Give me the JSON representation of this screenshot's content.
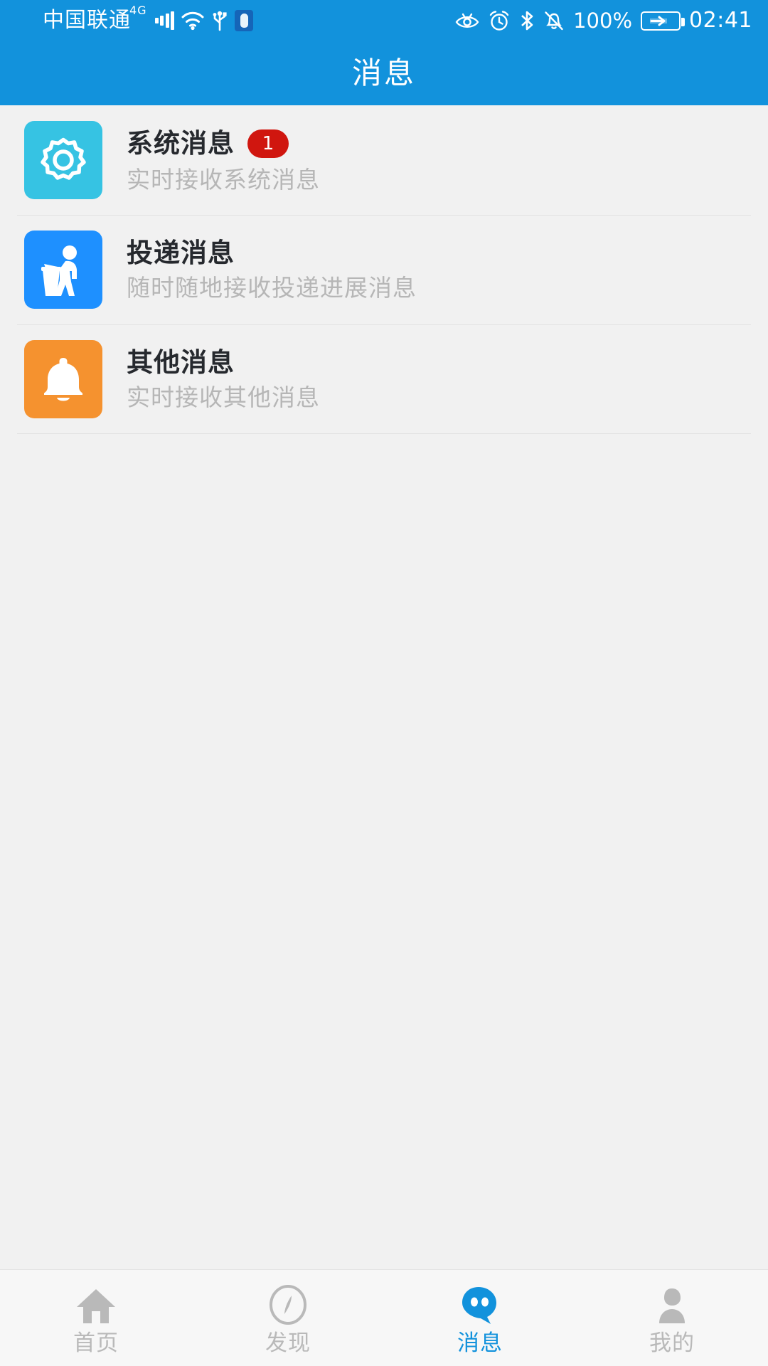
{
  "statusbar": {
    "carrier": "中国联通",
    "network_type": "4G",
    "signal_icon": "signal-bars-icon",
    "wifi_icon": "wifi-icon",
    "usb_icon": "usb-icon",
    "shield_icon": "shield-icon",
    "eye_icon": "eye-comfort-icon",
    "alarm_icon": "alarm-clock-icon",
    "bluetooth_icon": "bluetooth-icon",
    "mute_icon": "bell-muted-icon",
    "battery_percent": "100%",
    "battery_icon": "battery-charging-icon",
    "time": "02:41"
  },
  "header": {
    "title": "消息"
  },
  "main": {
    "items": [
      {
        "title": "系统消息",
        "subtitle": "实时接收系统消息",
        "badge": "1",
        "icon": "gear-icon",
        "icon_bg": "#36c3e3",
        "badge_color": "#d0160f"
      },
      {
        "title": "投递消息",
        "subtitle": "随时随地接收投递进展消息",
        "badge": "",
        "icon": "delivery-person-icon",
        "icon_bg": "#1e90ff",
        "badge_color": "#d0160f"
      },
      {
        "title": "其他消息",
        "subtitle": "实时接收其他消息",
        "badge": "",
        "icon": "bell-icon",
        "icon_bg": "#f5922f",
        "badge_color": "#d0160f"
      }
    ]
  },
  "tabbar": {
    "accent_color": "#1292dc",
    "inactive_color": "#b9b9b9",
    "items": [
      {
        "label": "首页",
        "icon": "home-icon",
        "active": false
      },
      {
        "label": "发现",
        "icon": "compass-icon",
        "active": false
      },
      {
        "label": "消息",
        "icon": "chat-bubble-icon",
        "active": true
      },
      {
        "label": "我的",
        "icon": "person-icon",
        "active": false
      }
    ]
  }
}
